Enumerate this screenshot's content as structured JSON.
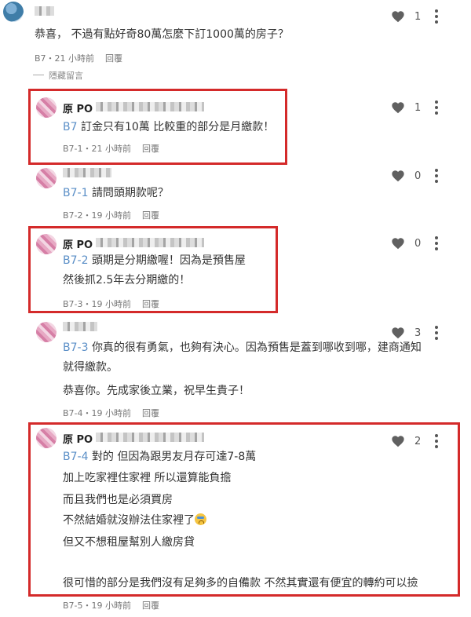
{
  "comments": [
    {
      "name": "",
      "text": [
        "恭喜， 不過有點好奇80萬怎麼下訂1000萬的房子？"
      ],
      "meta": "B7・21 小時前",
      "reply": "回覆",
      "likes": "1"
    },
    {
      "name": "原 PO",
      "tag": "B7",
      "text": [
        "訂金只有10萬 比較重的部分是月繳款！"
      ],
      "meta": "B7-1・21 小時前",
      "reply": "回覆",
      "likes": "1"
    },
    {
      "name": "",
      "tag": "B7-1",
      "text": [
        "請問頭期款呢？"
      ],
      "meta": "B7-2・19 小時前",
      "reply": "回覆",
      "likes": "0"
    },
    {
      "name": "原 PO",
      "tag": "B7-2",
      "text": [
        "頭期是分期繳喔！因為是預售屋",
        "然後抓2.5年去分期繳的！"
      ],
      "meta": "B7-3・19 小時前",
      "reply": "回覆",
      "likes": "0"
    },
    {
      "name": "",
      "tag": "B7-3",
      "text": [
        "你真的很有勇氣，也夠有決心。因為預售是蓋到哪收到哪，建商通知",
        "就得繳款。",
        "恭喜你。先成家後立業，祝早生貴子！"
      ],
      "meta": "B7-4・19 小時前",
      "reply": "回覆",
      "likes": "3"
    },
    {
      "name": "原 PO",
      "tag": "B7-4",
      "text": [
        "對的 但因為跟男友月存可達7-8萬",
        "加上吃家裡住家裡 所以還算能負擔",
        "而且我們也是必須買房",
        "不然結婚就沒辦法住家裡了",
        "但又不想租屋幫別人繳房貸",
        "",
        "很可惜的部分是我們沒有足夠多的自備款 不然其實還有便宜的轉約可以撿"
      ],
      "meta": "B7-5・19 小時前",
      "reply": "回覆",
      "likes": "2"
    }
  ],
  "hidden_label": "隱藏留言",
  "colors": {
    "highlight": "#d42a2a",
    "tag": "#5b8fc7",
    "heart": "#606060"
  }
}
